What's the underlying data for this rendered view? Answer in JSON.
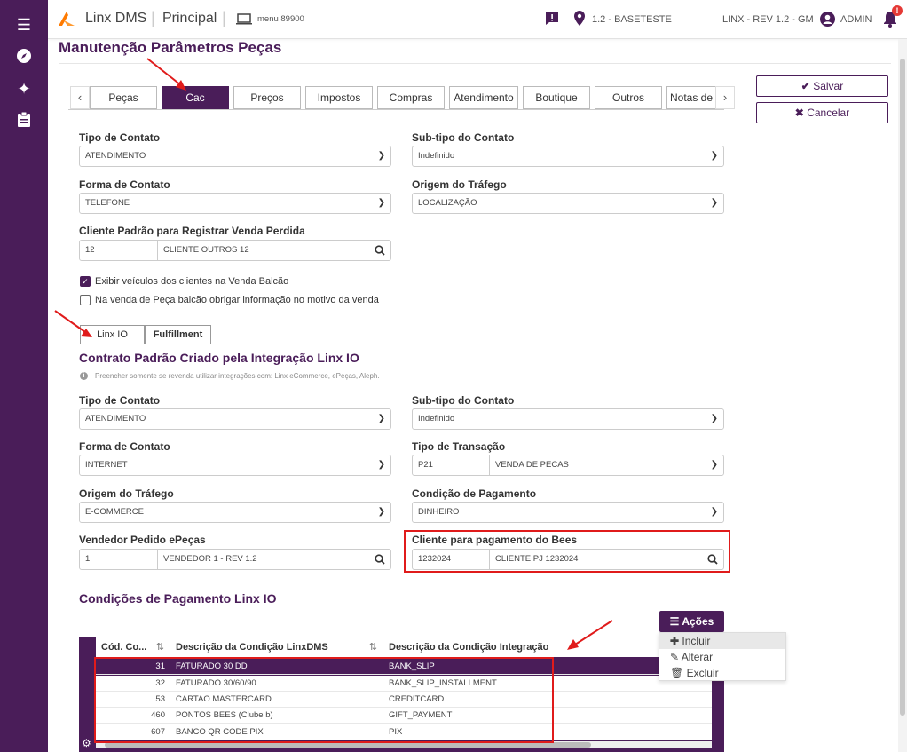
{
  "app": {
    "logo_text": "Linx DMS",
    "module": "Principal",
    "menu_label": "menu 89900",
    "company": "1.2 - BASETESTE",
    "revision": "LINX - REV 1.2 - GM",
    "user": "ADMIN",
    "notification_badge": "!",
    "brand_color": "#4a1d59",
    "accent_color": "#ff7a00"
  },
  "page": {
    "title": "Manutenção Parâmetros Peças"
  },
  "tabs": [
    {
      "label": "Peças"
    },
    {
      "label": "Cac"
    },
    {
      "label": "Preços"
    },
    {
      "label": "Impostos"
    },
    {
      "label": "Compras"
    },
    {
      "label": "Atendimento"
    },
    {
      "label": "Boutique"
    },
    {
      "label": "Outros"
    },
    {
      "label": "Notas de"
    }
  ],
  "actions": {
    "save": "Salvar",
    "cancel": "Cancelar"
  },
  "cac": {
    "tipo_contato": {
      "label": "Tipo de Contato",
      "value": "ATENDIMENTO"
    },
    "subtipo_contato": {
      "label": "Sub-tipo do Contato",
      "value": "Indefinido"
    },
    "forma_contato": {
      "label": "Forma de Contato",
      "value": "TELEFONE"
    },
    "origem_trafego": {
      "label": "Origem do Tráfego",
      "value": "LOCALIZAÇÃO"
    },
    "cliente_padrao": {
      "label": "Cliente Padrão para Registrar Venda Perdida",
      "code": "12",
      "name": "CLIENTE OUTROS 12"
    },
    "check1": {
      "label": "Exibir veículos dos clientes na Venda Balcão"
    },
    "check2": {
      "label": "Na venda de Peça balcão obrigar informação no motivo da venda"
    }
  },
  "subtabs": [
    {
      "label": "Linx IO"
    },
    {
      "label": "Fulfillment"
    }
  ],
  "linxio": {
    "section_title": "Contrato Padrão Criado pela Integração Linx IO",
    "hint": "Preencher somente se revenda utilizar integrações com: Linx eCommerce, ePeças, Aleph.",
    "tipo_contato": {
      "label": "Tipo de Contato",
      "value": "ATENDIMENTO"
    },
    "subtipo_contato": {
      "label": "Sub-tipo do Contato",
      "value": "Indefinido"
    },
    "forma_contato": {
      "label": "Forma de Contato",
      "value": "INTERNET"
    },
    "tipo_transacao": {
      "label": "Tipo de Transação",
      "code": "P21",
      "value": "VENDA DE PECAS"
    },
    "origem_trafego": {
      "label": "Origem do Tráfego",
      "value": "E-COMMERCE"
    },
    "condicao_pagamento": {
      "label": "Condição de Pagamento",
      "value": "DINHEIRO"
    },
    "vendedor": {
      "label": "Vendedor Pedido ePeças",
      "code": "1",
      "name": "VENDEDOR 1 - REV 1.2"
    },
    "cliente_bees": {
      "label": "Cliente para pagamento do Bees",
      "code": "1232024",
      "name": "CLIENTE PJ 1232024"
    }
  },
  "payment_conditions": {
    "title": "Condições de Pagamento Linx IO",
    "actions_label": "Ações",
    "columns": [
      "Cód. Co...",
      "Descrição da Condição LinxDMS",
      "Descrição da Condição Integração"
    ],
    "rows": [
      [
        "31",
        "FATURADO 30 DD",
        "BANK_SLIP"
      ],
      [
        "32",
        "FATURADO 30/60/90",
        "BANK_SLIP_INSTALLMENT"
      ],
      [
        "53",
        "CARTAO MASTERCARD",
        "CREDITCARD"
      ],
      [
        "460",
        "PONTOS BEES (Clube b)",
        "GIFT_PAYMENT"
      ],
      [
        "607",
        "BANCO QR CODE PIX",
        "PIX"
      ]
    ],
    "menu": [
      {
        "label": "Incluir"
      },
      {
        "label": "Alterar"
      },
      {
        "label": "Excluir"
      }
    ]
  }
}
